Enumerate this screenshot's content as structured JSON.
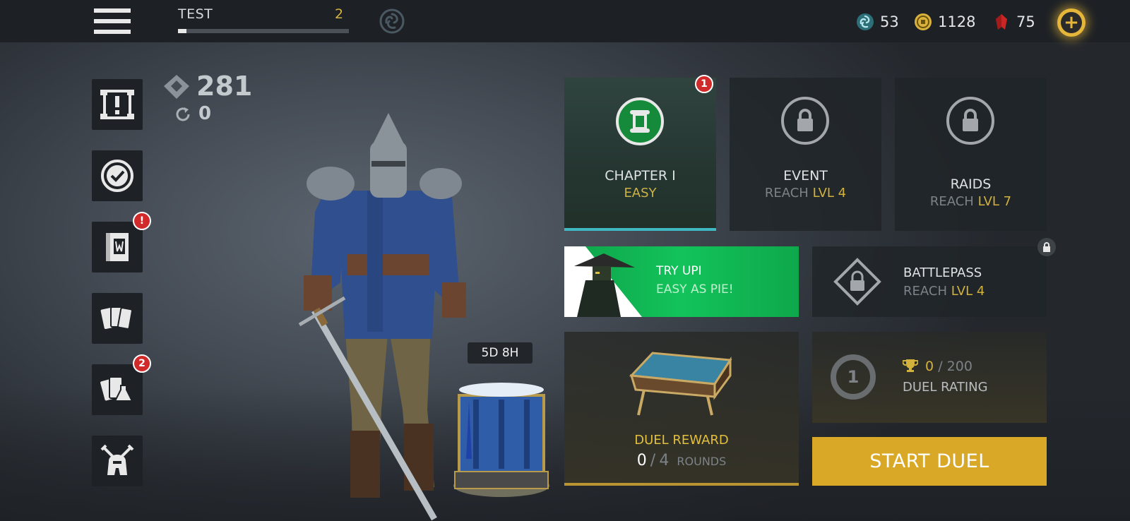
{
  "player": {
    "name": "TEST",
    "level": "2",
    "xp_progress": 0.05
  },
  "currencies": {
    "spirit": "53",
    "coins": "1128",
    "gems": "75"
  },
  "stats": {
    "power": "281",
    "resets": "0"
  },
  "sidebar": {
    "items": [
      {
        "name": "scroll-challenges",
        "badge": ""
      },
      {
        "name": "checkmark-quests",
        "badge": ""
      },
      {
        "name": "codex-book",
        "badge": "!"
      },
      {
        "name": "cards",
        "badge": ""
      },
      {
        "name": "inventory-cards",
        "badge": "2"
      },
      {
        "name": "crossed-swords-helmet",
        "badge": ""
      }
    ]
  },
  "tiles": {
    "chapter": {
      "title": "CHAPTER I",
      "sub": "EASY",
      "badge": "1"
    },
    "event": {
      "title": "EVENT",
      "reach": "REACH",
      "level": "LVL 4"
    },
    "raids": {
      "title": "RAIDS",
      "reach": "REACH",
      "level": "LVL 7"
    },
    "try_upi": {
      "title": "TRY UPI",
      "sub": "EASY AS PIE!"
    },
    "battlepass": {
      "title": "BATTLEPASS",
      "reach": "REACH",
      "level": "LVL 4"
    },
    "duel_reward": {
      "title": "DUEL REWARD",
      "current": "0",
      "sep": "/",
      "total": "4",
      "unit": "ROUNDS"
    },
    "duel_rating": {
      "rank": "1",
      "current": "0",
      "sep": "/",
      "max": "200",
      "label": "DUEL RATING"
    }
  },
  "chest_timer": "5D 8H",
  "start_duel_label": "START DUEL",
  "colors": {
    "gold": "#d2b13c",
    "green": "#12c35a",
    "badge_red": "#d12a2a",
    "start_duel": "#d8a826"
  }
}
